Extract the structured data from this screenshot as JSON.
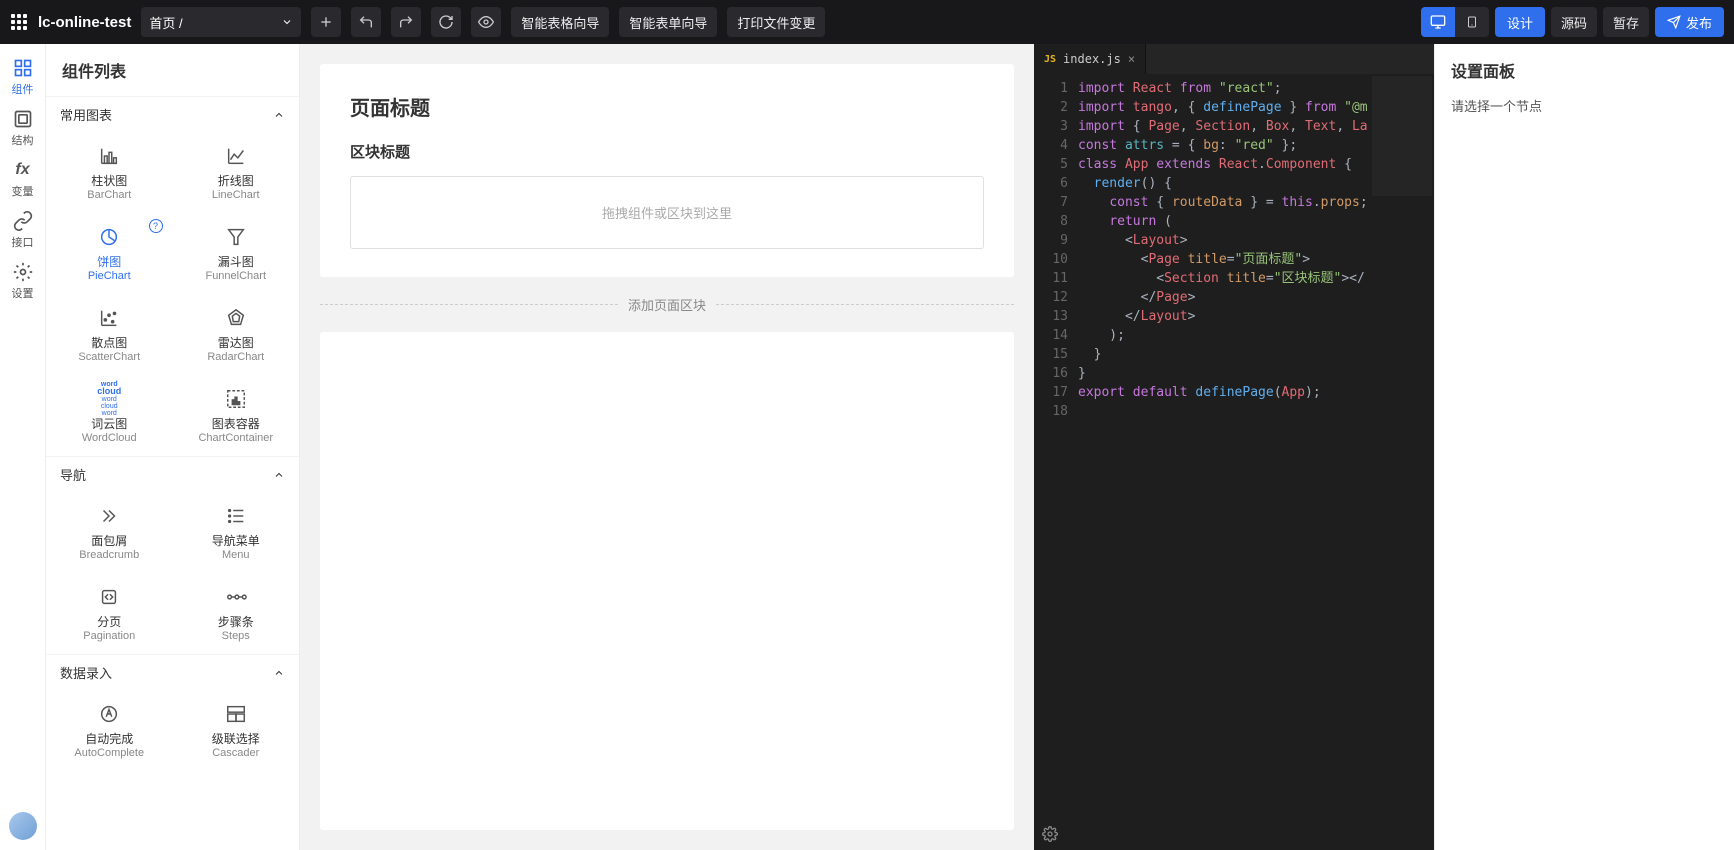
{
  "topbar": {
    "project_name": "lc-online-test",
    "breadcrumb": "首页 /",
    "actions": {
      "smart_table": "智能表格向导",
      "smart_form": "智能表单向导",
      "print_file": "打印文件变更"
    },
    "right": {
      "design": "设计",
      "source": "源码",
      "draft": "暂存",
      "publish": "发布"
    }
  },
  "left_rail": [
    {
      "key": "components",
      "label": "组件"
    },
    {
      "key": "structure",
      "label": "结构"
    },
    {
      "key": "variables",
      "label": "变量"
    },
    {
      "key": "api",
      "label": "接口"
    },
    {
      "key": "settings",
      "label": "设置"
    }
  ],
  "component_panel": {
    "title": "组件列表",
    "groups": [
      {
        "name": "常用图表",
        "items": [
          {
            "cn": "柱状图",
            "en": "BarChart",
            "icon": "bar"
          },
          {
            "cn": "折线图",
            "en": "LineChart",
            "icon": "line"
          },
          {
            "cn": "饼图",
            "en": "PieChart",
            "icon": "pie",
            "selected": true,
            "help": true
          },
          {
            "cn": "漏斗图",
            "en": "FunnelChart",
            "icon": "funnel"
          },
          {
            "cn": "散点图",
            "en": "ScatterChart",
            "icon": "scatter"
          },
          {
            "cn": "雷达图",
            "en": "RadarChart",
            "icon": "radar"
          },
          {
            "cn": "词云图",
            "en": "WordCloud",
            "icon": "wordcloud"
          },
          {
            "cn": "图表容器",
            "en": "ChartContainer",
            "icon": "container"
          }
        ]
      },
      {
        "name": "导航",
        "items": [
          {
            "cn": "面包屑",
            "en": "Breadcrumb",
            "icon": "breadcrumb"
          },
          {
            "cn": "导航菜单",
            "en": "Menu",
            "icon": "menu"
          },
          {
            "cn": "分页",
            "en": "Pagination",
            "icon": "pagination"
          },
          {
            "cn": "步骤条",
            "en": "Steps",
            "icon": "steps"
          }
        ]
      },
      {
        "name": "数据录入",
        "items": [
          {
            "cn": "自动完成",
            "en": "AutoComplete",
            "icon": "autocomplete"
          },
          {
            "cn": "级联选择",
            "en": "Cascader",
            "icon": "cascader"
          }
        ]
      }
    ]
  },
  "canvas": {
    "page_title": "页面标题",
    "section_title": "区块标题",
    "drop_hint": "拖拽组件或区块到这里",
    "add_section": "添加页面区块"
  },
  "editor": {
    "filename": "index.js",
    "lines": [
      [
        [
          "kw",
          "import"
        ],
        [
          "pl",
          " "
        ],
        [
          "id",
          "React"
        ],
        [
          "pl",
          " "
        ],
        [
          "kw",
          "from"
        ],
        [
          "pl",
          " "
        ],
        [
          "str",
          "\"react\""
        ],
        [
          "pl",
          ";"
        ]
      ],
      [
        [
          "kw",
          "import"
        ],
        [
          "pl",
          " "
        ],
        [
          "id",
          "tango"
        ],
        [
          "pl",
          ", { "
        ],
        [
          "fn",
          "definePage"
        ],
        [
          "pl",
          " } "
        ],
        [
          "kw",
          "from"
        ],
        [
          "pl",
          " "
        ],
        [
          "str",
          "\"@m"
        ]
      ],
      [
        [
          "kw",
          "import"
        ],
        [
          "pl",
          " { "
        ],
        [
          "id",
          "Page"
        ],
        [
          "pl",
          ", "
        ],
        [
          "id",
          "Section"
        ],
        [
          "pl",
          ", "
        ],
        [
          "id",
          "Box"
        ],
        [
          "pl",
          ", "
        ],
        [
          "id",
          "Text"
        ],
        [
          "pl",
          ", "
        ],
        [
          "id",
          "La"
        ]
      ],
      [
        [
          "kw",
          "const"
        ],
        [
          "pl",
          " "
        ],
        [
          "def",
          "attrs"
        ],
        [
          "pl",
          " = { "
        ],
        [
          "prop",
          "bg"
        ],
        [
          "pl",
          ": "
        ],
        [
          "str",
          "\"red\""
        ],
        [
          "pl",
          " };"
        ]
      ],
      [
        [
          "kw",
          "class"
        ],
        [
          "pl",
          " "
        ],
        [
          "id",
          "App"
        ],
        [
          "pl",
          " "
        ],
        [
          "kw",
          "extends"
        ],
        [
          "pl",
          " "
        ],
        [
          "id",
          "React"
        ],
        [
          "pl",
          "."
        ],
        [
          "id",
          "Component"
        ],
        [
          "pl",
          " {"
        ]
      ],
      [
        [
          "pl",
          "  "
        ],
        [
          "fn",
          "render"
        ],
        [
          "pl",
          "() {"
        ]
      ],
      [
        [
          "pl",
          "    "
        ],
        [
          "kw",
          "const"
        ],
        [
          "pl",
          " { "
        ],
        [
          "prop",
          "routeData"
        ],
        [
          "pl",
          " } = "
        ],
        [
          "kw",
          "this"
        ],
        [
          "pl",
          "."
        ],
        [
          "prop",
          "props"
        ],
        [
          "pl",
          ";"
        ]
      ],
      [
        [
          "pl",
          "    "
        ],
        [
          "kw",
          "return"
        ],
        [
          "pl",
          " ("
        ]
      ],
      [
        [
          "pl",
          "      <"
        ],
        [
          "id",
          "Layout"
        ],
        [
          "pl",
          ">"
        ]
      ],
      [
        [
          "pl",
          "        <"
        ],
        [
          "id",
          "Page"
        ],
        [
          "pl",
          " "
        ],
        [
          "attr",
          "title"
        ],
        [
          "pl",
          "="
        ],
        [
          "str",
          "\"页面标题\""
        ],
        [
          "pl",
          ">"
        ]
      ],
      [
        [
          "pl",
          "          <"
        ],
        [
          "id",
          "Section"
        ],
        [
          "pl",
          " "
        ],
        [
          "attr",
          "title"
        ],
        [
          "pl",
          "="
        ],
        [
          "str",
          "\"区块标题\""
        ],
        [
          "pl",
          "></"
        ]
      ],
      [
        [
          "pl",
          "        </"
        ],
        [
          "id",
          "Page"
        ],
        [
          "pl",
          ">"
        ]
      ],
      [
        [
          "pl",
          "      </"
        ],
        [
          "id",
          "Layout"
        ],
        [
          "pl",
          ">"
        ]
      ],
      [
        [
          "pl",
          "    );"
        ]
      ],
      [
        [
          "pl",
          "  }"
        ]
      ],
      [
        [
          "pl",
          "}"
        ]
      ],
      [
        [
          "kw",
          "export"
        ],
        [
          "pl",
          " "
        ],
        [
          "kw",
          "default"
        ],
        [
          "pl",
          " "
        ],
        [
          "fn",
          "definePage"
        ],
        [
          "pl",
          "("
        ],
        [
          "id",
          "App"
        ],
        [
          "pl",
          ");"
        ]
      ],
      [
        [
          "pl",
          ""
        ]
      ]
    ]
  },
  "right_panel": {
    "title": "设置面板",
    "hint": "请选择一个节点"
  }
}
